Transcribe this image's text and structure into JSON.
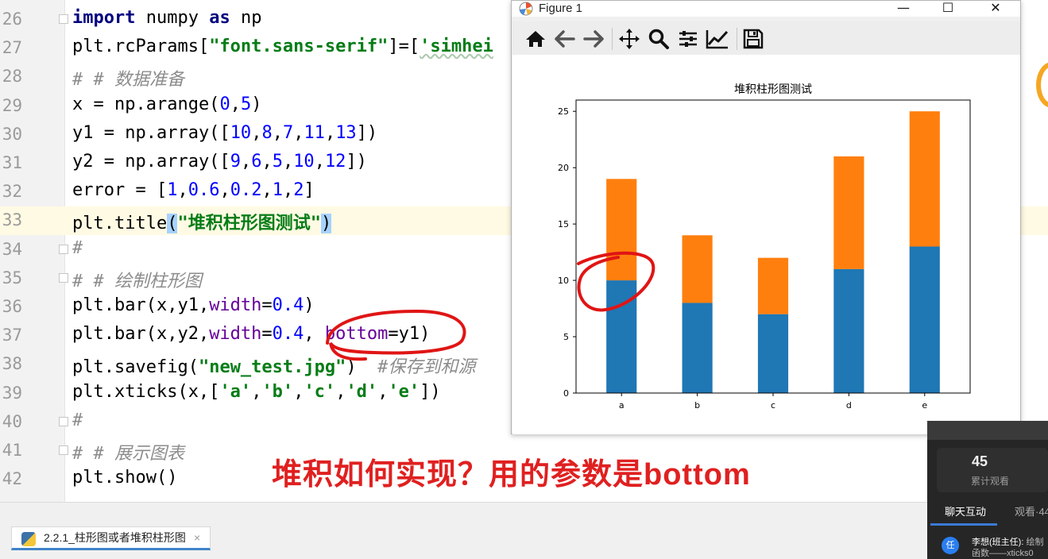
{
  "editor": {
    "lines": [
      {
        "num": "26",
        "parts": [
          {
            "t": "import",
            "c": "kw"
          },
          {
            "t": " numpy "
          },
          {
            "t": "as",
            "c": "kw"
          },
          {
            "t": " np"
          }
        ]
      },
      {
        "num": "27",
        "parts": [
          {
            "t": "plt.rcParams["
          },
          {
            "t": "\"font.sans-serif\"",
            "c": "str"
          },
          {
            "t": "]=["
          },
          {
            "t": "'simhei",
            "c": "str wavy"
          }
        ]
      },
      {
        "num": "28",
        "parts": [
          {
            "t": "# # 数据准备",
            "c": "cmt"
          }
        ]
      },
      {
        "num": "29",
        "parts": [
          {
            "t": "x = np.arange("
          },
          {
            "t": "0",
            "c": "num"
          },
          {
            "t": ","
          },
          {
            "t": "5",
            "c": "num"
          },
          {
            "t": ")"
          }
        ]
      },
      {
        "num": "30",
        "parts": [
          {
            "t": "y1 = np.array(["
          },
          {
            "t": "10",
            "c": "num"
          },
          {
            "t": ","
          },
          {
            "t": "8",
            "c": "num"
          },
          {
            "t": ","
          },
          {
            "t": "7",
            "c": "num"
          },
          {
            "t": ","
          },
          {
            "t": "11",
            "c": "num"
          },
          {
            "t": ","
          },
          {
            "t": "13",
            "c": "num"
          },
          {
            "t": "])"
          }
        ]
      },
      {
        "num": "31",
        "parts": [
          {
            "t": "y2 = np.array(["
          },
          {
            "t": "9",
            "c": "num"
          },
          {
            "t": ","
          },
          {
            "t": "6",
            "c": "num"
          },
          {
            "t": ","
          },
          {
            "t": "5",
            "c": "num"
          },
          {
            "t": ","
          },
          {
            "t": "10",
            "c": "num"
          },
          {
            "t": ","
          },
          {
            "t": "12",
            "c": "num"
          },
          {
            "t": "])"
          }
        ]
      },
      {
        "num": "32",
        "parts": [
          {
            "t": "error = ["
          },
          {
            "t": "1",
            "c": "num"
          },
          {
            "t": ","
          },
          {
            "t": "0.6",
            "c": "num"
          },
          {
            "t": ","
          },
          {
            "t": "0.2",
            "c": "num"
          },
          {
            "t": ","
          },
          {
            "t": "1",
            "c": "num"
          },
          {
            "t": ","
          },
          {
            "t": "2",
            "c": "num"
          },
          {
            "t": "]"
          }
        ]
      },
      {
        "num": "33",
        "parts": [
          {
            "t": "plt.title"
          },
          {
            "t": "(",
            "c": "selq"
          },
          {
            "t": "\"堆积柱形图测试\"",
            "c": "str"
          },
          {
            "t": ")",
            "c": "selq"
          }
        ]
      },
      {
        "num": "34",
        "parts": [
          {
            "t": "#",
            "c": "cmt"
          }
        ]
      },
      {
        "num": "35",
        "parts": [
          {
            "t": "# # 绘制柱形图",
            "c": "cmt"
          }
        ]
      },
      {
        "num": "36",
        "parts": [
          {
            "t": "plt.bar(x,y1,"
          },
          {
            "t": "width",
            "c": "kwarg"
          },
          {
            "t": "="
          },
          {
            "t": "0.4",
            "c": "num"
          },
          {
            "t": ")"
          }
        ]
      },
      {
        "num": "37",
        "parts": [
          {
            "t": "plt.bar(x,y2,"
          },
          {
            "t": "width",
            "c": "kwarg"
          },
          {
            "t": "="
          },
          {
            "t": "0.4",
            "c": "num"
          },
          {
            "t": ", "
          },
          {
            "t": "bottom",
            "c": "kwarg"
          },
          {
            "t": "=y1)"
          }
        ]
      },
      {
        "num": "38",
        "parts": [
          {
            "t": "plt.savefig("
          },
          {
            "t": "\"new_test.jpg\"",
            "c": "str"
          },
          {
            "t": ")  "
          },
          {
            "t": "#保存到和源",
            "c": "cmt"
          }
        ]
      },
      {
        "num": "39",
        "parts": [
          {
            "t": "plt.xticks(x,["
          },
          {
            "t": "'a'",
            "c": "str"
          },
          {
            "t": ","
          },
          {
            "t": "'b'",
            "c": "str"
          },
          {
            "t": ","
          },
          {
            "t": "'c'",
            "c": "str"
          },
          {
            "t": ","
          },
          {
            "t": "'d'",
            "c": "str"
          },
          {
            "t": ","
          },
          {
            "t": "'e'",
            "c": "str"
          },
          {
            "t": "])"
          }
        ]
      },
      {
        "num": "40",
        "parts": [
          {
            "t": "#",
            "c": "cmt"
          }
        ]
      },
      {
        "num": "41",
        "parts": [
          {
            "t": "# # 展示图表",
            "c": "cmt"
          }
        ]
      },
      {
        "num": "42",
        "parts": [
          {
            "t": "plt.show()"
          }
        ]
      }
    ]
  },
  "tab": {
    "label": "2.2.1_柱形图或者堆积柱形图",
    "close": "×"
  },
  "annotation": "堆积如何实现？用的参数是bottom",
  "figure_window": {
    "title": "Figure 1",
    "controls": {
      "minimize": "—",
      "maximize": "☐",
      "close": "✕"
    },
    "toolbar": [
      "home-icon",
      "back-arrow-icon",
      "forward-arrow-icon",
      "pan-icon",
      "zoom-icon",
      "subplots-icon",
      "edit-axis-icon",
      "save-icon"
    ]
  },
  "chart_data": {
    "type": "bar",
    "stacked": true,
    "title": "堆积柱形图测试",
    "categories": [
      "a",
      "b",
      "c",
      "d",
      "e"
    ],
    "series": [
      {
        "values": [
          10,
          8,
          7,
          11,
          13
        ],
        "color": "#1f77b4"
      },
      {
        "values": [
          9,
          6,
          5,
          10,
          12
        ],
        "color": "#ff7f0e"
      }
    ],
    "ylim": [
      0,
      26
    ],
    "yticks": [
      0,
      5,
      10,
      15,
      20,
      25
    ],
    "xlabel": "",
    "ylabel": "",
    "grid": false
  },
  "live_panel": {
    "count": "45",
    "count_label": "累计观看",
    "tab_chat": "聊天互动",
    "tab_viewers": "观看·44",
    "avatar": "任",
    "msg_user": "李想(班主任):",
    "msg_text": "绘制",
    "msg_line2": "函数——xticks0"
  },
  "colors": {
    "accent_red": "#e02020",
    "bar_blue": "#1f77b4",
    "bar_orange": "#ff7f0e"
  }
}
